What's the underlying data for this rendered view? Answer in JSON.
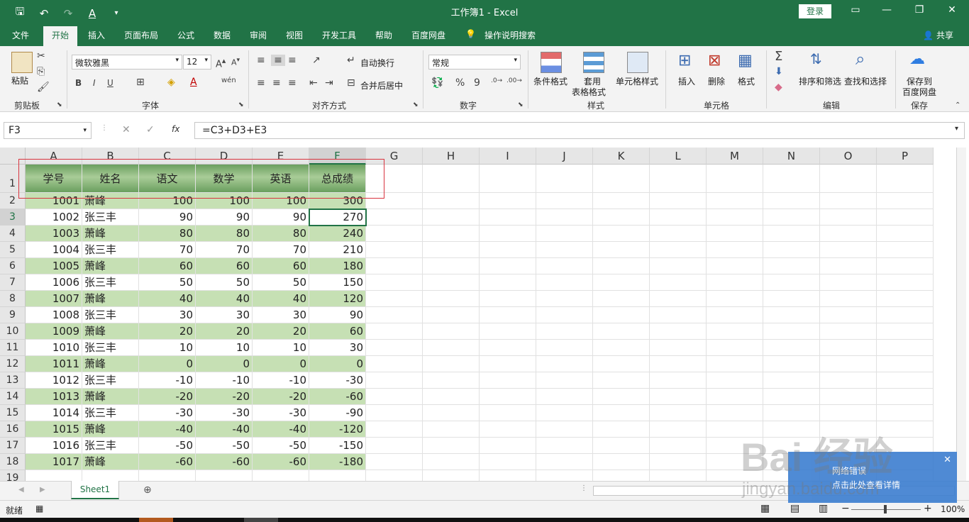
{
  "title_bar": {
    "title": "工作簿1  -  Excel",
    "login": "登录"
  },
  "tabs": [
    "文件",
    "开始",
    "插入",
    "页面布局",
    "公式",
    "数据",
    "审阅",
    "视图",
    "开发工具",
    "帮助",
    "百度网盘",
    "操作说明搜索"
  ],
  "share": "共享",
  "ribbon": {
    "clipboard": {
      "paste": "粘贴",
      "group": "剪贴板"
    },
    "font": {
      "name": "微软雅黑",
      "size": "12",
      "bold": "B",
      "italic": "I",
      "underline": "U",
      "group": "字体"
    },
    "alignment": {
      "wrap": "自动换行",
      "merge": "合并后居中",
      "group": "对齐方式"
    },
    "number": {
      "format": "常规",
      "percent": "%",
      "comma": "9",
      "group": "数字"
    },
    "styles": {
      "conditional": "条件格式",
      "table_line1": "套用",
      "table_line2": "表格格式",
      "cell_styles": "单元格样式",
      "group": "样式"
    },
    "cells": {
      "insert": "插入",
      "delete": "删除",
      "format": "格式",
      "group": "单元格"
    },
    "editing": {
      "sort": "排序和筛选",
      "find": "查找和选择",
      "group": "编辑"
    },
    "save": {
      "line1": "保存到",
      "line2": "百度网盘",
      "group": "保存"
    }
  },
  "formula_bar": {
    "name_box": "F3",
    "fx": "fx",
    "formula": "=C3+D3+E3"
  },
  "columns": [
    "A",
    "B",
    "C",
    "D",
    "E",
    "F",
    "G",
    "H",
    "I",
    "J",
    "K",
    "L",
    "M",
    "N",
    "O",
    "P"
  ],
  "header_row": [
    "学号",
    "姓名",
    "语文",
    "数学",
    "英语",
    "总成绩"
  ],
  "rows": [
    [
      "1001",
      "萧峰",
      "100",
      "100",
      "100",
      "300"
    ],
    [
      "1002",
      "张三丰",
      "90",
      "90",
      "90",
      "270"
    ],
    [
      "1003",
      "萧峰",
      "80",
      "80",
      "80",
      "240"
    ],
    [
      "1004",
      "张三丰",
      "70",
      "70",
      "70",
      "210"
    ],
    [
      "1005",
      "萧峰",
      "60",
      "60",
      "60",
      "180"
    ],
    [
      "1006",
      "张三丰",
      "50",
      "50",
      "50",
      "150"
    ],
    [
      "1007",
      "萧峰",
      "40",
      "40",
      "40",
      "120"
    ],
    [
      "1008",
      "张三丰",
      "30",
      "30",
      "30",
      "90"
    ],
    [
      "1009",
      "萧峰",
      "20",
      "20",
      "20",
      "60"
    ],
    [
      "1010",
      "张三丰",
      "10",
      "10",
      "10",
      "30"
    ],
    [
      "1011",
      "萧峰",
      "0",
      "0",
      "0",
      "0"
    ],
    [
      "1012",
      "张三丰",
      "-10",
      "-10",
      "-10",
      "-30"
    ],
    [
      "1013",
      "萧峰",
      "-20",
      "-20",
      "-20",
      "-60"
    ],
    [
      "1014",
      "张三丰",
      "-30",
      "-30",
      "-30",
      "-90"
    ],
    [
      "1015",
      "萧峰",
      "-40",
      "-40",
      "-40",
      "-120"
    ],
    [
      "1016",
      "张三丰",
      "-50",
      "-50",
      "-50",
      "-150"
    ],
    [
      "1017",
      "萧峰",
      "-60",
      "-60",
      "-60",
      "-180"
    ]
  ],
  "sheet_tab": "Sheet1",
  "status": {
    "ready": "就绪",
    "zoom": "100%"
  },
  "popup": {
    "title": "网络错误",
    "text": "点击此处查看详情",
    "close": "✕"
  },
  "watermark": {
    "main": "Bai 经验",
    "sub": "jingyan.baidu.com"
  },
  "colors": {
    "excel_green": "#217346",
    "stripe": "#c6e0b4",
    "selection_box": "#d9343f"
  }
}
